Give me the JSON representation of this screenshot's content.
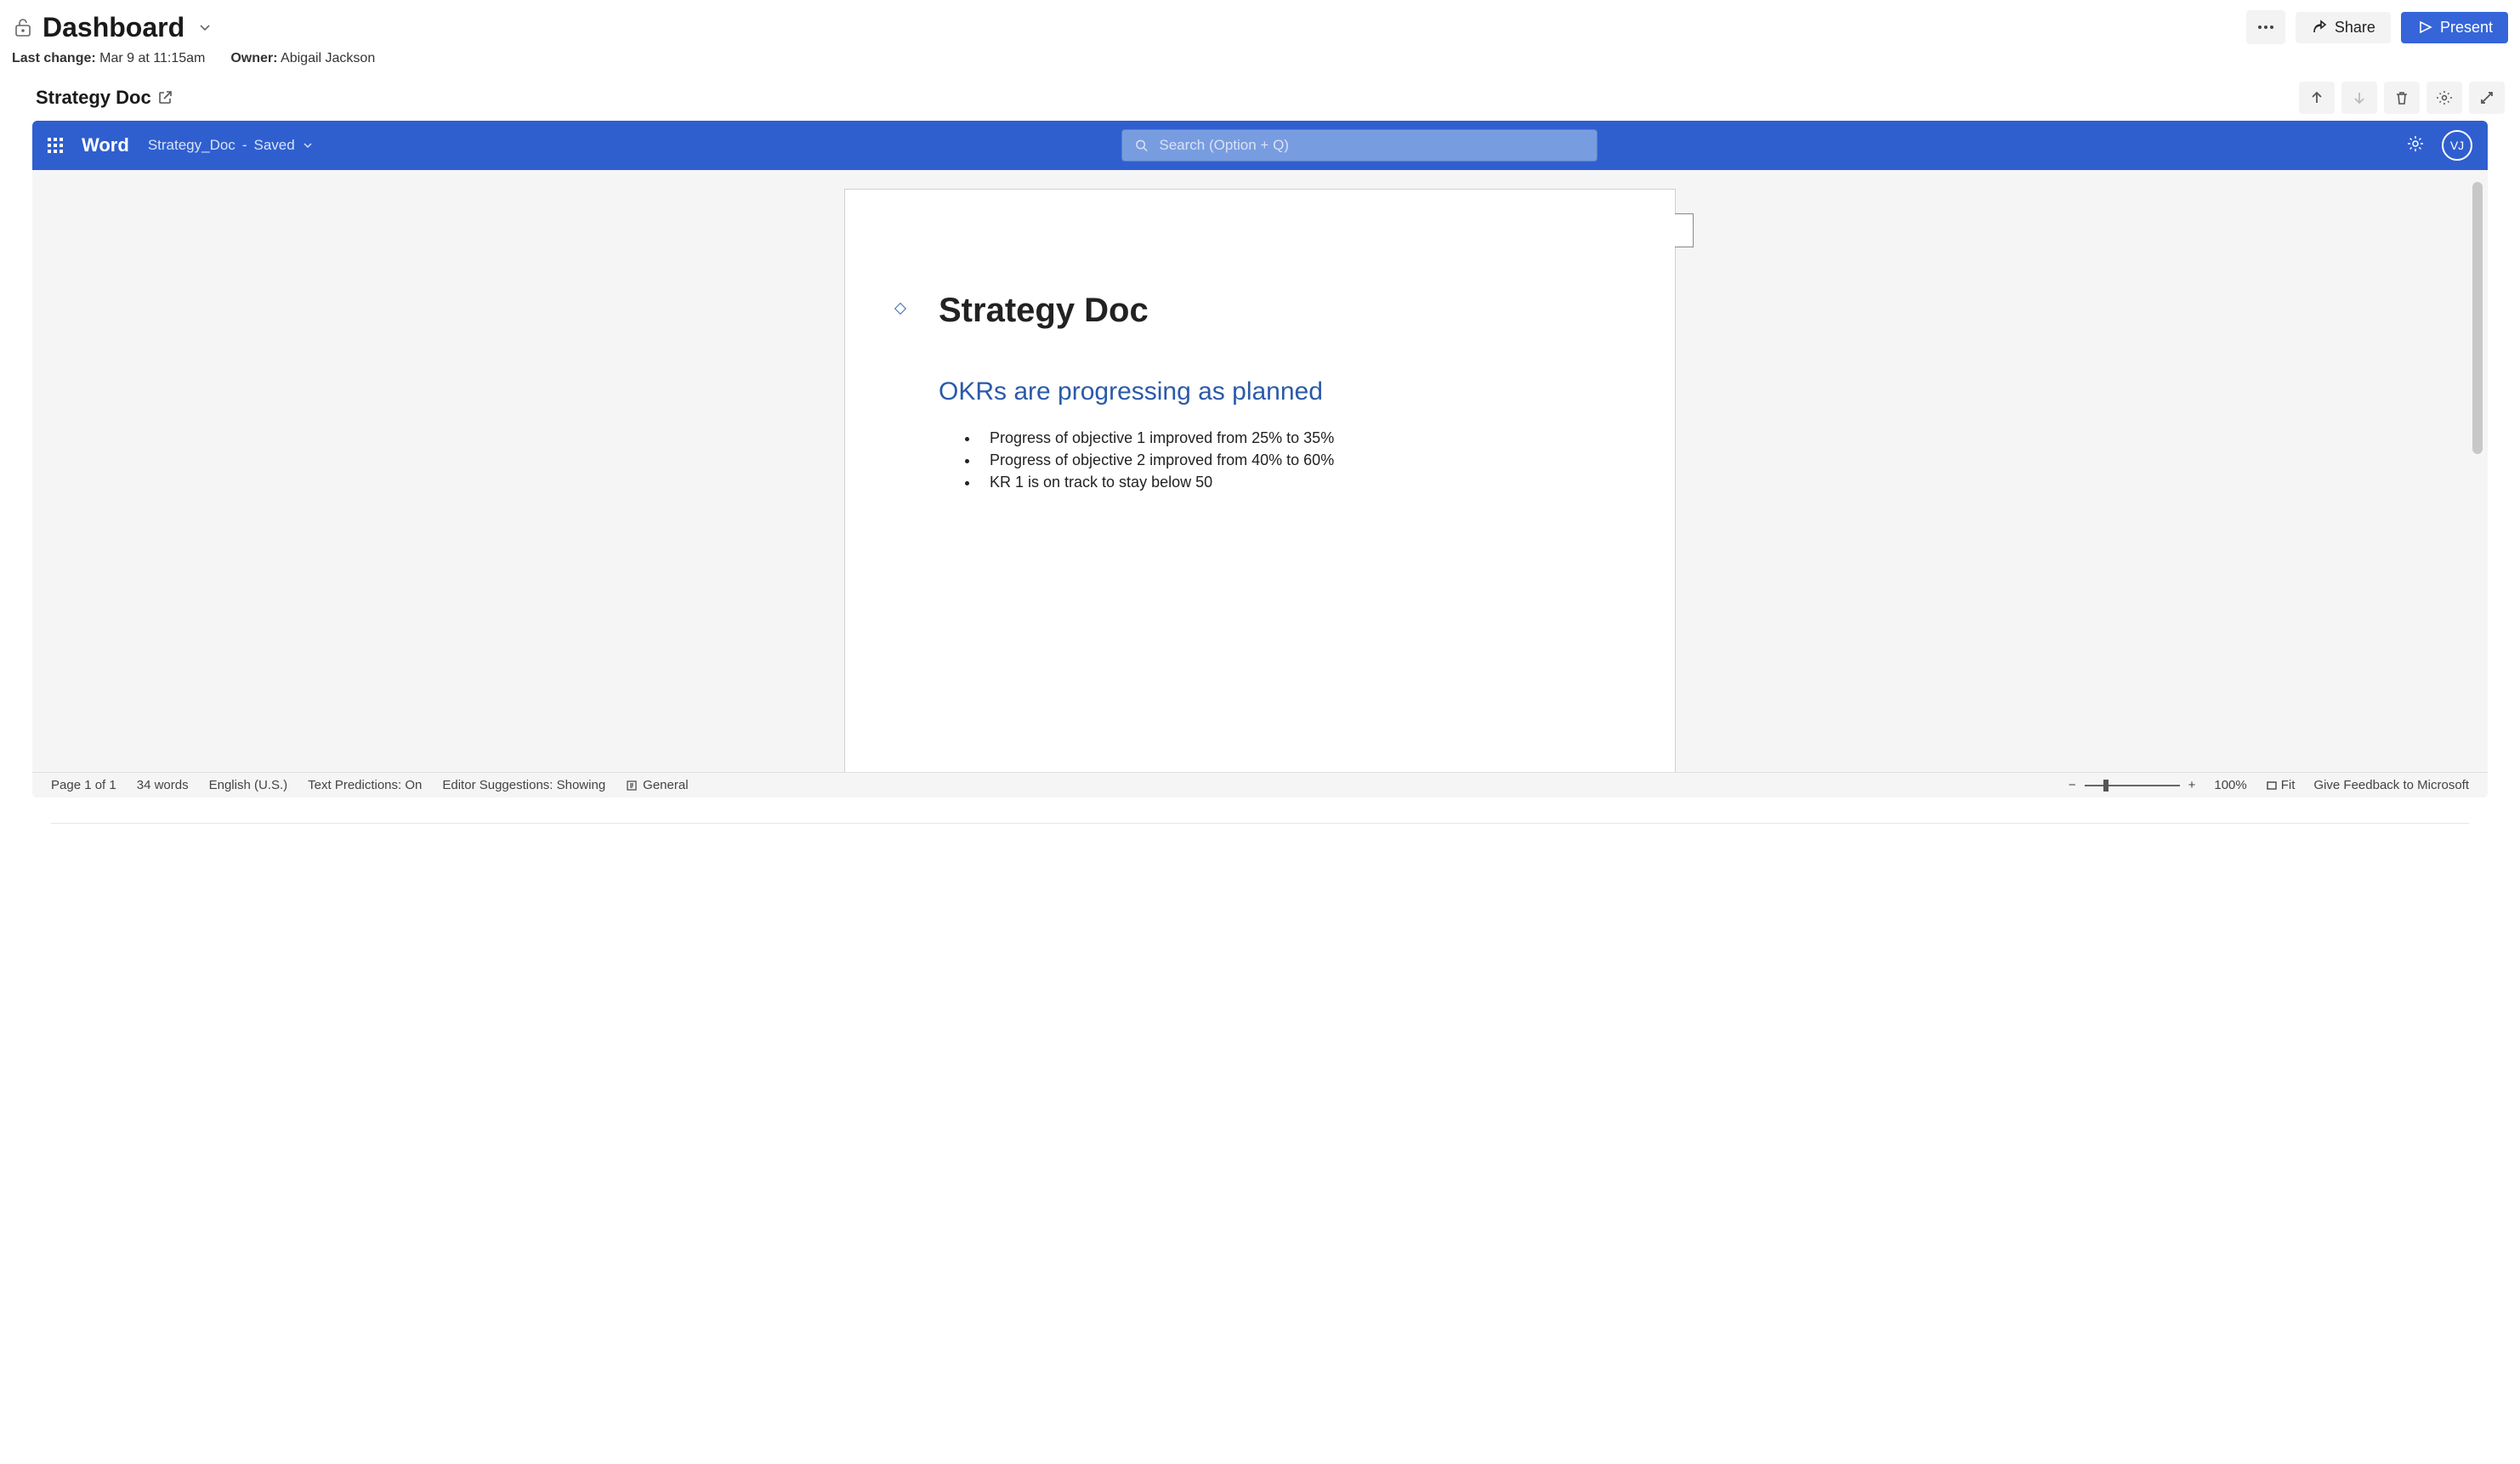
{
  "header": {
    "title": "Dashboard",
    "last_change_label": "Last change:",
    "last_change_value": "Mar 9 at 11:15am",
    "owner_label": "Owner:",
    "owner_value": "Abigail Jackson",
    "share_label": "Share",
    "present_label": "Present"
  },
  "section": {
    "title": "Strategy Doc"
  },
  "word": {
    "brand": "Word",
    "doc_name": "Strategy_Doc",
    "save_state": "Saved",
    "search_placeholder": "Search (Option + Q)",
    "avatar_initials": "VJ"
  },
  "document": {
    "h1": "Strategy Doc",
    "h2": "OKRs are progressing as planned",
    "bullets": [
      "Progress of objective 1 improved from 25% to 35%",
      "Progress of objective 2 improved from 40% to 60%",
      "KR 1 is on track to stay below 50"
    ]
  },
  "statusbar": {
    "page": "Page 1 of 1",
    "words": "34 words",
    "language": "English (U.S.)",
    "predictions": "Text Predictions: On",
    "editor": "Editor Suggestions: Showing",
    "accessibility": "General",
    "zoom": "100%",
    "fit": "Fit",
    "feedback": "Give Feedback to Microsoft"
  }
}
